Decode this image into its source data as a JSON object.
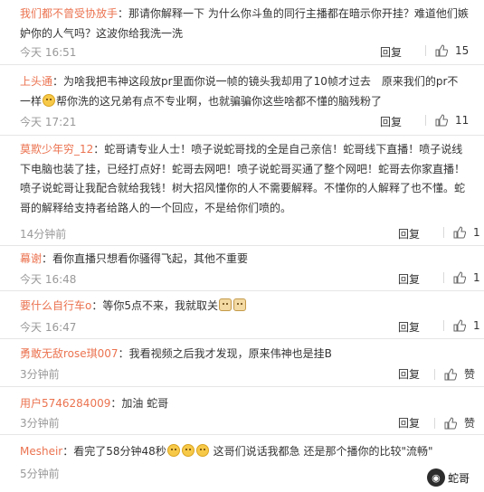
{
  "reply_label": "回复",
  "colors": {
    "username": "#eb7350",
    "meta": "#999999",
    "text": "#333333"
  },
  "comments": [
    {
      "user": "我们都不曾受协放手",
      "text1": "：那请你解释一下 为什么你斗鱼的同行主播都在暗示你开挂？难道他们嫉妒你的人气吗？这波你给我洗一洗",
      "text2": "",
      "time": "今天 16:51",
      "likes": "15"
    },
    {
      "user": "上头通",
      "text1": "：为啥我把韦神这段放pr里面你说一帧的镜头我却用了10帧才过去　原来我们的pr不一样",
      "text2": "帮你洗的这兄弟有点不专业啊，也就骗骗你这些啥都不懂的脑残粉了",
      "time": "今天 17:21",
      "likes": "11"
    },
    {
      "user": "莫欺少年穷_12",
      "text1": "：蛇哥请专业人士！喷子说蛇哥找的全是自己亲信！蛇哥线下直播！喷子说线下电脑也装了挂，已经打点好！蛇哥去网吧！喷子说蛇哥买通了整个网吧！蛇哥去你家直播！喷子说蛇哥让我配合就给我钱！树大招风懂你的人不需要解释。不懂你的人解释了也不懂。蛇哥的解释给支持者给路人的一个回应，不是给你们喷的。",
      "text2": "",
      "time": "14分钟前",
      "likes": "1"
    },
    {
      "user": "幕谢",
      "text1": "：看你直播只想看你骚得飞起，其他不重要",
      "text2": "",
      "time": "今天 16:48",
      "likes": "1"
    },
    {
      "user": "要什么自行车o",
      "text1": "：等你5点不来，我就取关",
      "text2": "",
      "time": "今天 16:47",
      "likes": "1"
    },
    {
      "user": "勇敢无敌rose琪007",
      "text1": "：我看视频之后我才发现，原来伟神也是挂B",
      "text2": "",
      "time": "3分钟前",
      "likes": "赞"
    },
    {
      "user": "用户5746284009",
      "text1": "：加油 蛇哥",
      "text2": "",
      "time": "3分钟前",
      "likes": "赞"
    },
    {
      "user": "Mesheir",
      "text1": "：看完了58分钟48秒",
      "text2": "这哥们说话我都急 还是那个播你的比较\"流畅\"",
      "time": "5分钟前",
      "likes": ""
    }
  ],
  "watermark": "蛇哥"
}
